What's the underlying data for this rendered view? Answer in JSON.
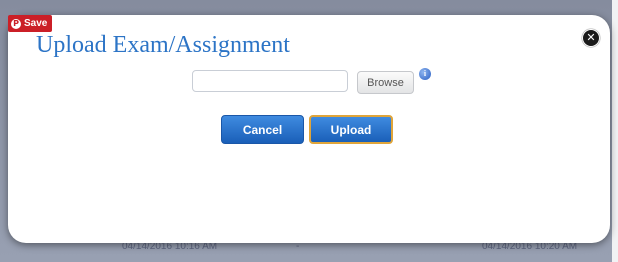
{
  "pinterest": {
    "label": "Save",
    "icon": "pinterest-icon"
  },
  "dialog": {
    "title": "Upload Exam/Assignment",
    "file_input_value": "",
    "browse_label": "Browse",
    "info_icon": "info-icon",
    "close_icon": "close-icon",
    "cancel_label": "Cancel",
    "upload_label": "Upload"
  },
  "background_row": {
    "start_time": "04/14/2016 10:16 AM",
    "separator": "-",
    "end_time": "04/14/2016 10:20 AM"
  },
  "colors": {
    "title": "#2c74c6",
    "button": "#2a74d0",
    "upload_border": "#e0a53a",
    "pin_red": "#cb1f27"
  }
}
